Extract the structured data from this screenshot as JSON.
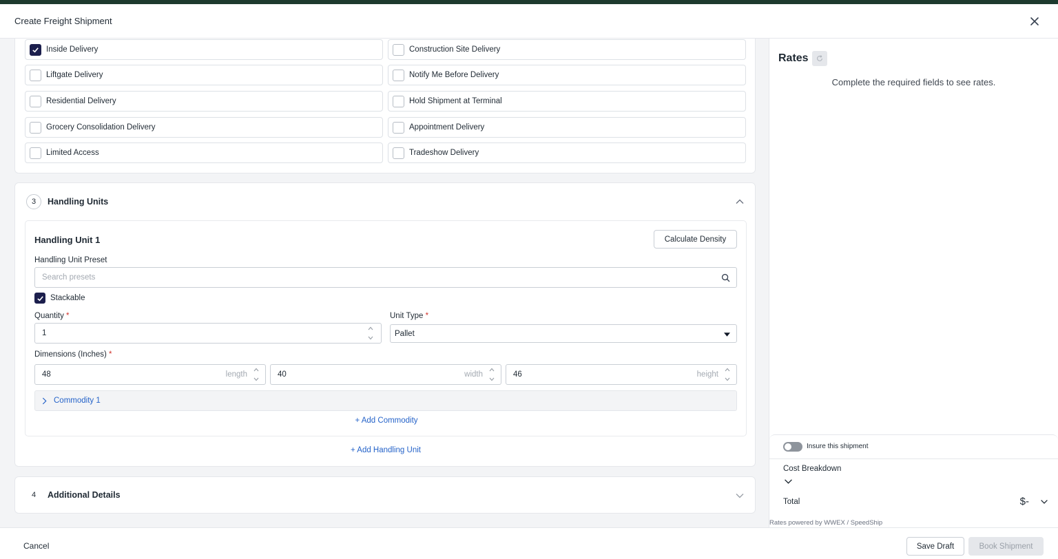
{
  "modal": {
    "title": "Create Freight Shipment"
  },
  "delivery_options": [
    {
      "label": "Inside Delivery",
      "checked": true
    },
    {
      "label": "Construction Site Delivery",
      "checked": false
    },
    {
      "label": "Liftgate Delivery",
      "checked": false
    },
    {
      "label": "Notify Me Before Delivery",
      "checked": false
    },
    {
      "label": "Residential Delivery",
      "checked": false
    },
    {
      "label": "Hold Shipment at Terminal",
      "checked": false
    },
    {
      "label": "Grocery Consolidation Delivery",
      "checked": false
    },
    {
      "label": "Appointment Delivery",
      "checked": false
    },
    {
      "label": "Limited Access",
      "checked": false
    },
    {
      "label": "Tradeshow Delivery",
      "checked": false
    }
  ],
  "handling_section": {
    "step": "3",
    "title": "Handling Units",
    "unit": {
      "title": "Handling Unit 1",
      "calculate_density_label": "Calculate Density",
      "preset_label": "Handling Unit Preset",
      "preset_placeholder": "Search presets",
      "stackable_label": "Stackable",
      "stackable_checked": true,
      "quantity_label": "Quantity",
      "quantity_value": "1",
      "unit_type_label": "Unit Type",
      "unit_type_value": "Pallet",
      "dimensions_label": "Dimensions (Inches)",
      "length_value": "48",
      "length_suffix": "length",
      "width_value": "40",
      "width_suffix": "width",
      "height_value": "46",
      "height_suffix": "height",
      "commodity_label": "Commodity 1",
      "add_commodity_label": "+ Add Commodity"
    },
    "add_unit_label": "+ Add Handling Unit"
  },
  "additional_section": {
    "step": "4",
    "title": "Additional Details"
  },
  "rates": {
    "title": "Rates",
    "message": "Complete the required fields to see rates.",
    "insure_label": "Insure this shipment",
    "cost_breakdown_label": "Cost Breakdown",
    "total_label": "Total",
    "total_value": "$-",
    "powered_by": "Rates powered by WWEX / SpeedShip"
  },
  "footer": {
    "cancel_label": "Cancel",
    "save_draft_label": "Save Draft",
    "book_label": "Book Shipment"
  },
  "colors": {
    "accent": "#1c1f4d",
    "link": "#2563c9",
    "required": "#d0342c"
  }
}
